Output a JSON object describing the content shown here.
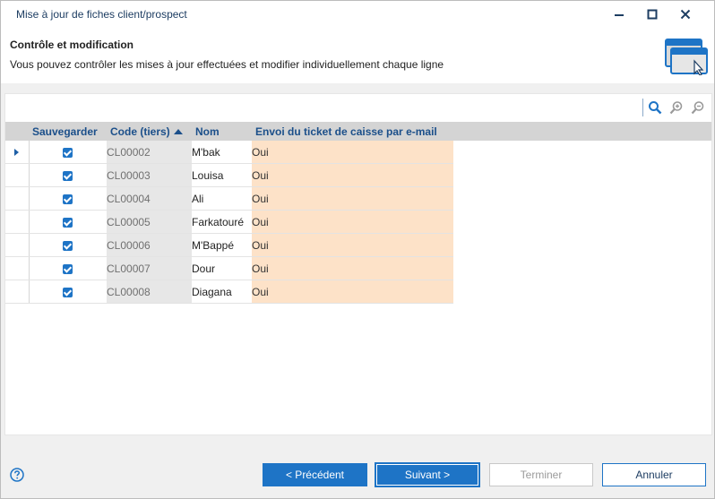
{
  "window": {
    "title": "Mise à jour de fiches client/prospect"
  },
  "header": {
    "title": "Contrôle et modification",
    "subtitle": "Vous pouvez contrôler les mises à jour effectuées et modifier individuellement chaque ligne"
  },
  "grid": {
    "columns": [
      "Sauvegarder",
      "Code (tiers)",
      "Nom",
      "Envoi du ticket de caisse par e-mail"
    ],
    "rows": [
      {
        "save": true,
        "code": "CL00002",
        "nom": "M'bak",
        "envoi": "Oui"
      },
      {
        "save": true,
        "code": "CL00003",
        "nom": "Louisa",
        "envoi": "Oui"
      },
      {
        "save": true,
        "code": "CL00004",
        "nom": "Ali",
        "envoi": "Oui"
      },
      {
        "save": true,
        "code": "CL00005",
        "nom": "Farkatouré",
        "envoi": "Oui"
      },
      {
        "save": true,
        "code": "CL00006",
        "nom": "M'Bappé",
        "envoi": "Oui"
      },
      {
        "save": true,
        "code": "CL00007",
        "nom": "Dour",
        "envoi": "Oui"
      },
      {
        "save": true,
        "code": "CL00008",
        "nom": "Diagana",
        "envoi": "Oui"
      }
    ],
    "sorted_column": "Code (tiers)",
    "sort_direction": "ascending",
    "current_row": 0
  },
  "toolbar": {
    "icons": [
      "search-icon",
      "zoom-in-icon",
      "zoom-out-icon"
    ]
  },
  "footer": {
    "previous": "< Précédent",
    "next": "Suivant >",
    "finish": "Terminer",
    "cancel": "Annuler"
  },
  "colors": {
    "accent": "#1e74c6",
    "highlight_column": "#fde2c8",
    "readonly_column": "#e7e7e7"
  }
}
